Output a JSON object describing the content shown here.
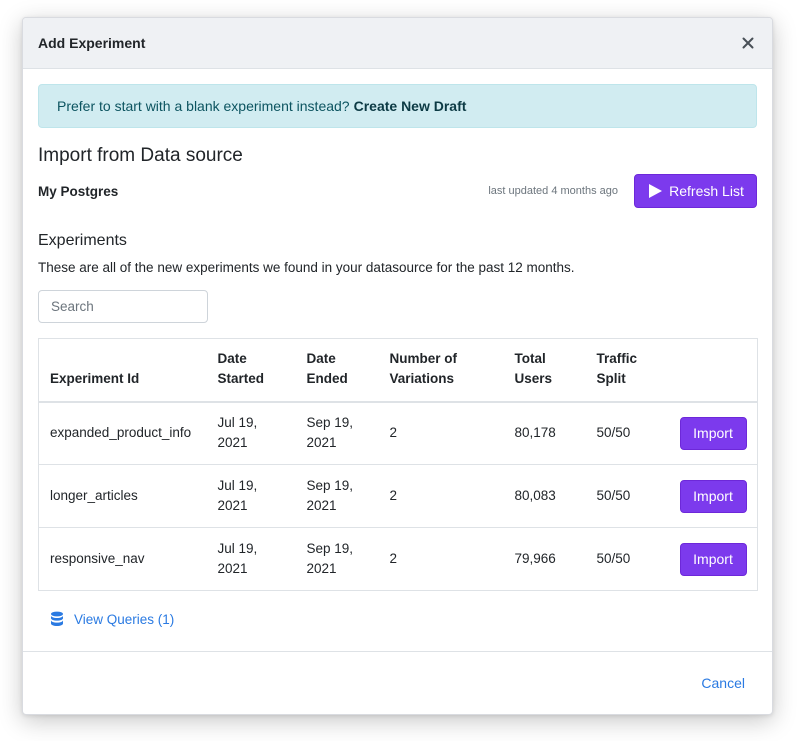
{
  "modal": {
    "title": "Add Experiment"
  },
  "alert": {
    "text": "Prefer to start with a blank experiment instead?",
    "link": "Create New Draft"
  },
  "import": {
    "heading": "Import from Data source",
    "datasource_name": "My Postgres",
    "last_updated": "last updated 4 months ago",
    "refresh_label": "Refresh List"
  },
  "experiments": {
    "heading": "Experiments",
    "description": "These are all of the new experiments we found in your datasource for the past 12 months.",
    "search_placeholder": "Search",
    "columns": [
      "Experiment Id",
      "Date Started",
      "Date Ended",
      "Number of Variations",
      "Total Users",
      "Traffic Split"
    ],
    "rows": [
      {
        "id": "expanded_product_info",
        "started": "Jul 19, 2021",
        "ended": "Sep 19, 2021",
        "variations": "2",
        "users": "80,178",
        "split": "50/50",
        "action": "Import"
      },
      {
        "id": "longer_articles",
        "started": "Jul 19, 2021",
        "ended": "Sep 19, 2021",
        "variations": "2",
        "users": "80,083",
        "split": "50/50",
        "action": "Import"
      },
      {
        "id": "responsive_nav",
        "started": "Jul 19, 2021",
        "ended": "Sep 19, 2021",
        "variations": "2",
        "users": "79,966",
        "split": "50/50",
        "action": "Import"
      }
    ],
    "view_queries": "View Queries (1)"
  },
  "footer": {
    "cancel": "Cancel"
  },
  "colors": {
    "accent": "#7c3aed",
    "link": "#2a7ae2",
    "alert_bg": "#d1ecf1"
  },
  "icons": {
    "close": "close-icon",
    "play": "play-icon",
    "database": "database-icon"
  }
}
